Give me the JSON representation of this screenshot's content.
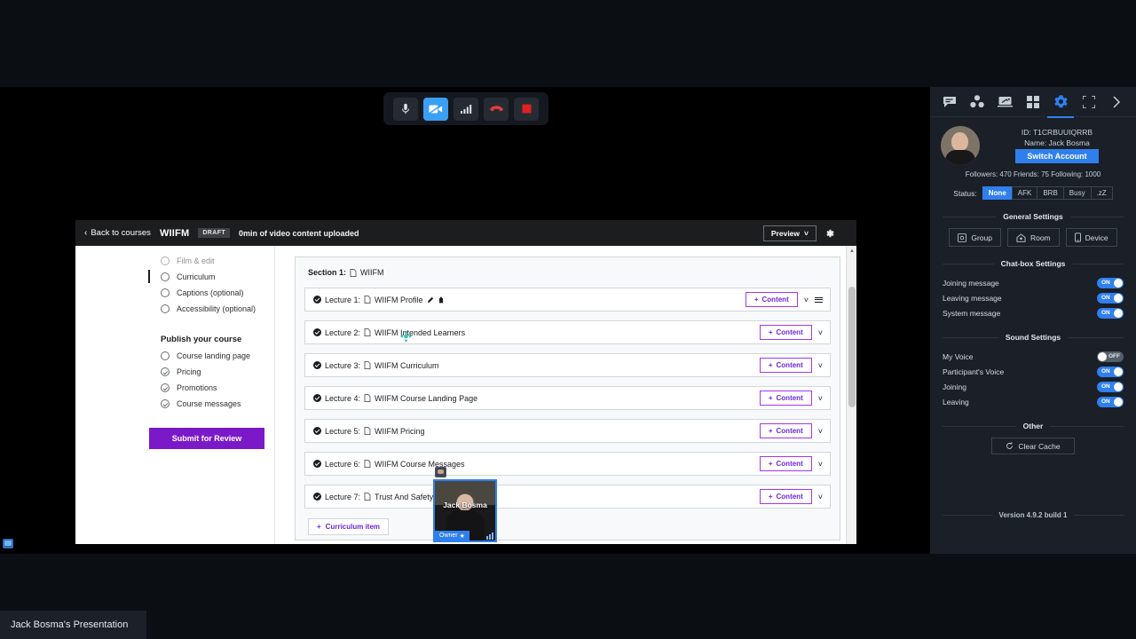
{
  "call_toolbar": {
    "buttons": [
      {
        "name": "microphone-button",
        "icon": "microphone-icon",
        "state": "on"
      },
      {
        "name": "camera-button",
        "icon": "camera-off-icon",
        "state": "active"
      },
      {
        "name": "network-stats-button",
        "icon": "signal-bars-icon",
        "state": "on"
      },
      {
        "name": "hangup-button",
        "icon": "phone-hangup-icon",
        "state": "on"
      },
      {
        "name": "record-button",
        "icon": "record-stop-icon",
        "state": "on"
      }
    ]
  },
  "shared_screen": {
    "udemy": {
      "header": {
        "back_label": "Back to courses",
        "course_title": "WIIFM",
        "draft_badge": "DRAFT",
        "upload_note": "0min of video content uploaded",
        "preview_label": "Preview",
        "settings_icon": "gear-icon"
      },
      "nav": {
        "items": [
          {
            "label": "Film & edit",
            "state": "todo",
            "clipped": true
          },
          {
            "label": "Curriculum",
            "state": "todo",
            "active": true
          },
          {
            "label": "Captions (optional)",
            "state": "todo"
          },
          {
            "label": "Accessibility (optional)",
            "state": "todo"
          }
        ],
        "group_title": "Publish your course",
        "publish_items": [
          {
            "label": "Course landing page",
            "state": "todo"
          },
          {
            "label": "Pricing",
            "state": "done"
          },
          {
            "label": "Promotions",
            "state": "done"
          },
          {
            "label": "Course messages",
            "state": "done"
          }
        ],
        "submit_label": "Submit for Review"
      },
      "curriculum": {
        "section_prefix": "Section 1:",
        "section_title": "WIIFM",
        "content_button_label": "Content",
        "add_item_label": "Curriculum item",
        "lectures": [
          {
            "prefix": "Lecture 1:",
            "title": "WIIFM Profile",
            "has_edit": true,
            "has_delete": true,
            "has_menu": true
          },
          {
            "prefix": "Lecture 2:",
            "title": "WIIFM Intended Learners"
          },
          {
            "prefix": "Lecture 3:",
            "title": "WIIFM Curriculum"
          },
          {
            "prefix": "Lecture 4:",
            "title": "WIIFM Course Landing Page"
          },
          {
            "prefix": "Lecture 5:",
            "title": "WIIFM Pricing"
          },
          {
            "prefix": "Lecture 6:",
            "title": "WIIFM Course Messages"
          },
          {
            "prefix": "Lecture 7:",
            "title": "Trust And Safety"
          }
        ]
      }
    }
  },
  "selfview": {
    "name": "Jack Bosma",
    "role_badge": "Owner",
    "role_star": "★"
  },
  "sidebar": {
    "tabs": [
      {
        "name": "chat-tab",
        "icon": "chat-icon",
        "active": false
      },
      {
        "name": "participants-tab",
        "icon": "group-icon",
        "active": false
      },
      {
        "name": "screenshare-tab",
        "icon": "screen-share-icon",
        "active": false
      },
      {
        "name": "layout-tab",
        "icon": "grid-icon",
        "active": false
      },
      {
        "name": "settings-tab",
        "icon": "gear-icon",
        "active": true
      },
      {
        "name": "fullscreen-tab",
        "icon": "fullscreen-icon",
        "active": false
      },
      {
        "name": "collapse-tab",
        "icon": "chevron-right-icon",
        "active": false
      }
    ],
    "profile": {
      "id_label": "ID: T1CRBUUIQRRB",
      "name_label": "Name: Jack Bosma",
      "switch_account_label": "Switch Account",
      "stats": "Followers: 470   Friends: 75   Following: 1000"
    },
    "status": {
      "label": "Status:",
      "options": [
        "None",
        "AFK",
        "BRB",
        "Busy",
        ".zZ"
      ],
      "selected": "None"
    },
    "general_settings": {
      "title": "General Settings",
      "buttons": [
        {
          "label": "Group",
          "icon": "group-settings-icon"
        },
        {
          "label": "Room",
          "icon": "room-icon"
        },
        {
          "label": "Device",
          "icon": "device-icon"
        }
      ]
    },
    "chatbox_settings": {
      "title": "Chat-box Settings",
      "toggles": [
        {
          "label": "Joining message",
          "value": "ON"
        },
        {
          "label": "Leaving message",
          "value": "ON"
        },
        {
          "label": "System message",
          "value": "ON"
        }
      ]
    },
    "sound_settings": {
      "title": "Sound Settings",
      "toggles": [
        {
          "label": "My Voice",
          "value": "OFF"
        },
        {
          "label": "Participant's Voice",
          "value": "ON"
        },
        {
          "label": "Joining",
          "value": "ON"
        },
        {
          "label": "Leaving",
          "value": "ON"
        }
      ]
    },
    "other": {
      "title": "Other",
      "clear_cache_label": "Clear Cache",
      "clear_cache_icon": "refresh-icon"
    },
    "version": "Version 4.9.2 build 1"
  },
  "taskbar": {
    "window_title": "Jack Bosma's Presentation"
  },
  "colors": {
    "accent_blue": "#2f80ed",
    "udemy_purple": "#a435f0",
    "sidebar_bg": "#1a1f28",
    "danger_red": "#e02020"
  }
}
